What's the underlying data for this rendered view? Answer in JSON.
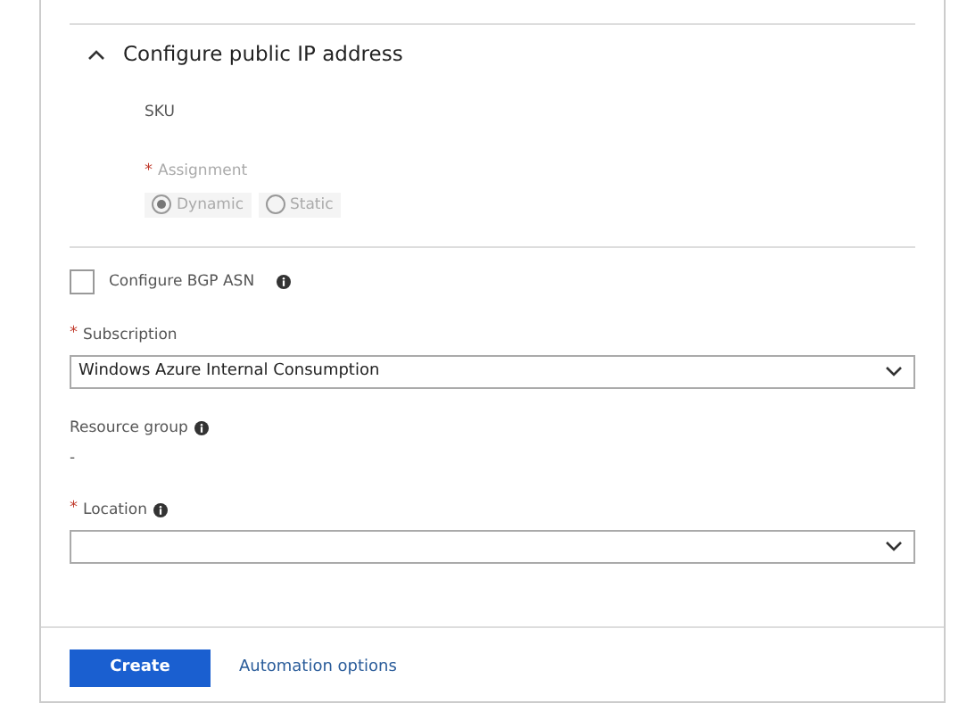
{
  "section": {
    "title": "Configure public IP address",
    "expanded": true,
    "sku_label": "SKU",
    "assignment": {
      "label": "Assignment",
      "required_mark": "*",
      "disabled": true,
      "options": [
        {
          "label": "Dynamic",
          "selected": true
        },
        {
          "label": "Static",
          "selected": false
        }
      ]
    }
  },
  "bgp": {
    "label": "Configure BGP ASN",
    "checked": false
  },
  "subscription": {
    "label": "Subscription",
    "required_mark": "*",
    "value": "Windows Azure Internal Consumption"
  },
  "resource_group": {
    "label": "Resource group",
    "value": "-"
  },
  "location": {
    "label": "Location",
    "required_mark": "*"
  },
  "footer": {
    "primary": "Create",
    "link": "Automation options"
  }
}
